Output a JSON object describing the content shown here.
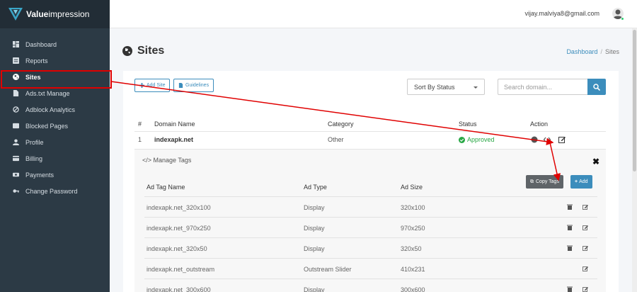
{
  "brand": {
    "bold": "Value",
    "light": "impression"
  },
  "sidebar": {
    "items": [
      {
        "label": "Dashboard",
        "icon": "dashboard-icon"
      },
      {
        "label": "Reports",
        "icon": "reports-icon"
      },
      {
        "label": "Sites",
        "icon": "globe-icon",
        "active": true
      },
      {
        "label": "Ads.txt Manage",
        "icon": "file-icon"
      },
      {
        "label": "Adblock Analytics",
        "icon": "ban-icon"
      },
      {
        "label": "Blocked Pages",
        "icon": "blocked-icon"
      },
      {
        "label": "Profile",
        "icon": "user-icon"
      },
      {
        "label": "Billing",
        "icon": "credit-card-icon"
      },
      {
        "label": "Payments",
        "icon": "payments-icon"
      },
      {
        "label": "Change Password",
        "icon": "key-icon"
      }
    ]
  },
  "header": {
    "email": "vijay.malviya8@gmail.com"
  },
  "page": {
    "title": "Sites",
    "breadcrumb": {
      "home": "Dashboard",
      "sep": "/",
      "current": "Sites"
    }
  },
  "toolbar": {
    "add_site": "Add Site",
    "guidelines": "Guidelines",
    "sort_value": "Sort By Status",
    "search_placeholder": "Search domain..."
  },
  "sites_table": {
    "headers": [
      "#",
      "Domain Name",
      "Category",
      "Status",
      "Action"
    ],
    "rows": [
      {
        "num": "1",
        "domain": "indexapk.net",
        "category": "Other",
        "status": "Approved"
      }
    ]
  },
  "tags_panel": {
    "title": "Manage Tags",
    "copy_tags": "Copy Tags",
    "add": "Add",
    "headers": [
      "Ad Tag Name",
      "Ad Type",
      "Ad Size"
    ],
    "rows": [
      {
        "name": "indexapk.net_320x100",
        "type": "Display",
        "size": "320x100",
        "deletable": true
      },
      {
        "name": "indexapk.net_970x250",
        "type": "Display",
        "size": "970x250",
        "deletable": true
      },
      {
        "name": "indexapk.net_320x50",
        "type": "Display",
        "size": "320x50",
        "deletable": true
      },
      {
        "name": "indexapk.net_outstream",
        "type": "Outstream Slider",
        "size": "410x231",
        "deletable": false
      },
      {
        "name": "indexapk.net_300x600",
        "type": "Display",
        "size": "300x600",
        "deletable": true
      }
    ]
  },
  "colors": {
    "sidebar": "#2c3a45",
    "accent": "#3c8dbc",
    "success": "#28a745",
    "annotation": "#e00000"
  }
}
